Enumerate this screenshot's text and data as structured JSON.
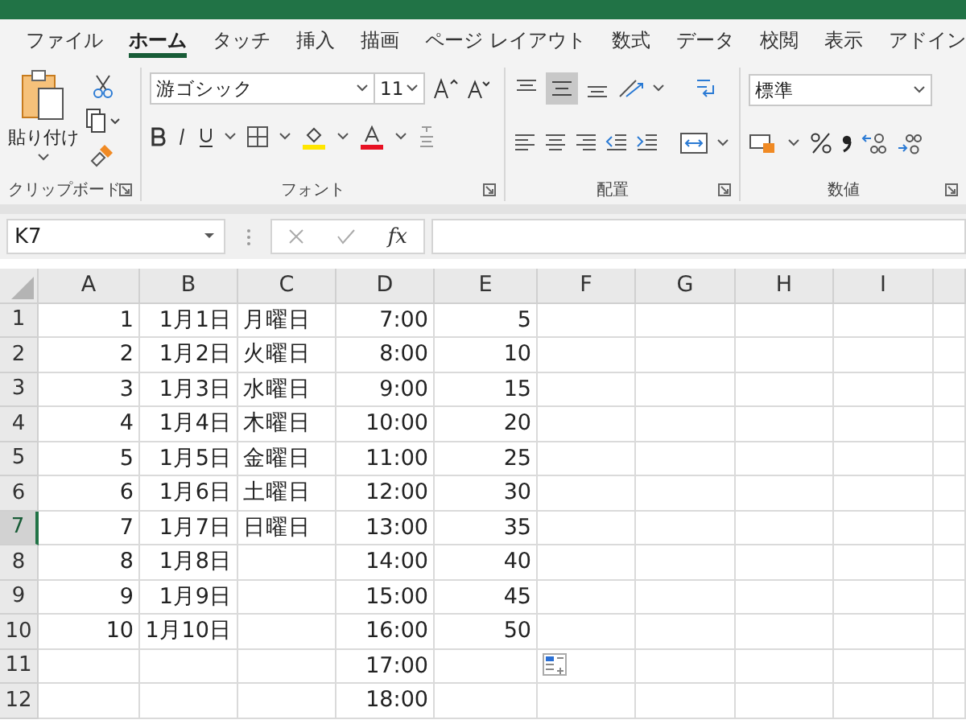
{
  "tabs": [
    {
      "label": "ファイル",
      "selected": false
    },
    {
      "label": "ホーム",
      "selected": true
    },
    {
      "label": "タッチ",
      "selected": false
    },
    {
      "label": "挿入",
      "selected": false
    },
    {
      "label": "描画",
      "selected": false
    },
    {
      "label": "ページ レイアウト",
      "selected": false
    },
    {
      "label": "数式",
      "selected": false
    },
    {
      "label": "データ",
      "selected": false
    },
    {
      "label": "校閲",
      "selected": false
    },
    {
      "label": "表示",
      "selected": false
    },
    {
      "label": "アドイン",
      "selected": false
    }
  ],
  "ribbon": {
    "paste_label": "貼り付け",
    "font_name": "游ゴシック",
    "font_size": "11",
    "number_format": "標準",
    "groups": [
      "クリップボード",
      "フォント",
      "配置",
      "数値"
    ]
  },
  "formula_bar": {
    "name_box": "K7",
    "fx_label": "fx"
  },
  "grid": {
    "columns": [
      "A",
      "B",
      "C",
      "D",
      "E",
      "F",
      "G",
      "H",
      "I"
    ],
    "rows": [
      {
        "header": "1",
        "selected": false,
        "cells": [
          {
            "text": "1",
            "kind": "number"
          },
          {
            "text": "1月1日",
            "kind": "number"
          },
          {
            "text": "月曜日",
            "kind": "text"
          },
          {
            "text": "7:00",
            "kind": "number"
          },
          {
            "text": "5",
            "kind": "number"
          }
        ]
      },
      {
        "header": "2",
        "selected": false,
        "cells": [
          {
            "text": "2",
            "kind": "number"
          },
          {
            "text": "1月2日",
            "kind": "number"
          },
          {
            "text": "火曜日",
            "kind": "text"
          },
          {
            "text": "8:00",
            "kind": "number"
          },
          {
            "text": "10",
            "kind": "number"
          }
        ]
      },
      {
        "header": "3",
        "selected": false,
        "cells": [
          {
            "text": "3",
            "kind": "number"
          },
          {
            "text": "1月3日",
            "kind": "number"
          },
          {
            "text": "水曜日",
            "kind": "text"
          },
          {
            "text": "9:00",
            "kind": "number"
          },
          {
            "text": "15",
            "kind": "number"
          }
        ]
      },
      {
        "header": "4",
        "selected": false,
        "cells": [
          {
            "text": "4",
            "kind": "number"
          },
          {
            "text": "1月4日",
            "kind": "number"
          },
          {
            "text": "木曜日",
            "kind": "text"
          },
          {
            "text": "10:00",
            "kind": "number"
          },
          {
            "text": "20",
            "kind": "number"
          }
        ]
      },
      {
        "header": "5",
        "selected": false,
        "cells": [
          {
            "text": "5",
            "kind": "number"
          },
          {
            "text": "1月5日",
            "kind": "number"
          },
          {
            "text": "金曜日",
            "kind": "text"
          },
          {
            "text": "11:00",
            "kind": "number"
          },
          {
            "text": "25",
            "kind": "number"
          }
        ]
      },
      {
        "header": "6",
        "selected": false,
        "cells": [
          {
            "text": "6",
            "kind": "number"
          },
          {
            "text": "1月6日",
            "kind": "number"
          },
          {
            "text": "土曜日",
            "kind": "text"
          },
          {
            "text": "12:00",
            "kind": "number"
          },
          {
            "text": "30",
            "kind": "number"
          }
        ]
      },
      {
        "header": "7",
        "selected": true,
        "cells": [
          {
            "text": "7",
            "kind": "number"
          },
          {
            "text": "1月7日",
            "kind": "number"
          },
          {
            "text": "日曜日",
            "kind": "text"
          },
          {
            "text": "13:00",
            "kind": "number"
          },
          {
            "text": "35",
            "kind": "number"
          }
        ]
      },
      {
        "header": "8",
        "selected": false,
        "cells": [
          {
            "text": "8",
            "kind": "number"
          },
          {
            "text": "1月8日",
            "kind": "number"
          },
          null,
          {
            "text": "14:00",
            "kind": "number"
          },
          {
            "text": "40",
            "kind": "number"
          }
        ]
      },
      {
        "header": "9",
        "selected": false,
        "cells": [
          {
            "text": "9",
            "kind": "number"
          },
          {
            "text": "1月9日",
            "kind": "number"
          },
          null,
          {
            "text": "15:00",
            "kind": "number"
          },
          {
            "text": "45",
            "kind": "number"
          }
        ]
      },
      {
        "header": "10",
        "selected": false,
        "cells": [
          {
            "text": "10",
            "kind": "number"
          },
          {
            "text": "1月10日",
            "kind": "number"
          },
          null,
          {
            "text": "16:00",
            "kind": "number"
          },
          {
            "text": "50",
            "kind": "number"
          }
        ]
      },
      {
        "header": "11",
        "selected": false,
        "cells": [
          null,
          null,
          null,
          {
            "text": "17:00",
            "kind": "number"
          },
          null
        ]
      },
      {
        "header": "12",
        "selected": false,
        "cells": [
          null,
          null,
          null,
          {
            "text": "18:00",
            "kind": "number"
          },
          null
        ]
      }
    ]
  }
}
